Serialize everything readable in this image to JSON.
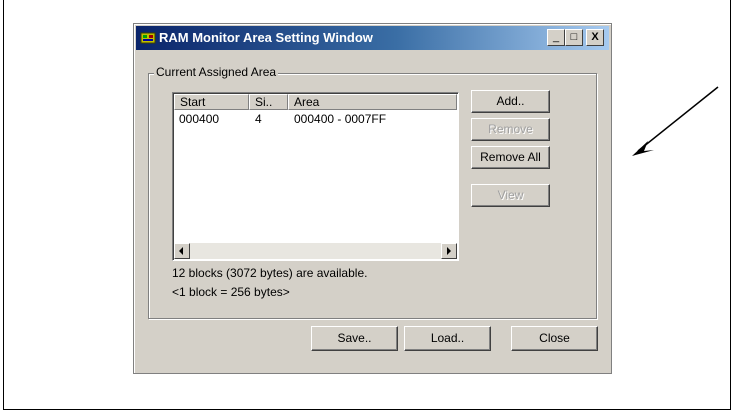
{
  "window": {
    "title": "RAM Monitor Area Setting Window",
    "minimize_glyph": "_",
    "maximize_glyph": "□",
    "close_glyph": "X"
  },
  "group": {
    "label": "Current Assigned Area"
  },
  "list": {
    "columns": [
      "Start",
      "Si..",
      "Area"
    ],
    "rows": [
      {
        "start": "000400",
        "size": "4",
        "area": "000400 - 0007FF"
      }
    ]
  },
  "buttons": {
    "add": "Add..",
    "remove": "Remove",
    "remove_all": "Remove All",
    "view": "View",
    "save": "Save..",
    "load": "Load..",
    "close": "Close"
  },
  "status": {
    "line1": "12 blocks (3072 bytes) are available.",
    "line2": "<1 block = 256 bytes>"
  },
  "colors": {
    "face": "#d4d0c8",
    "title_start": "#0a246a",
    "title_end": "#a6caf0"
  }
}
